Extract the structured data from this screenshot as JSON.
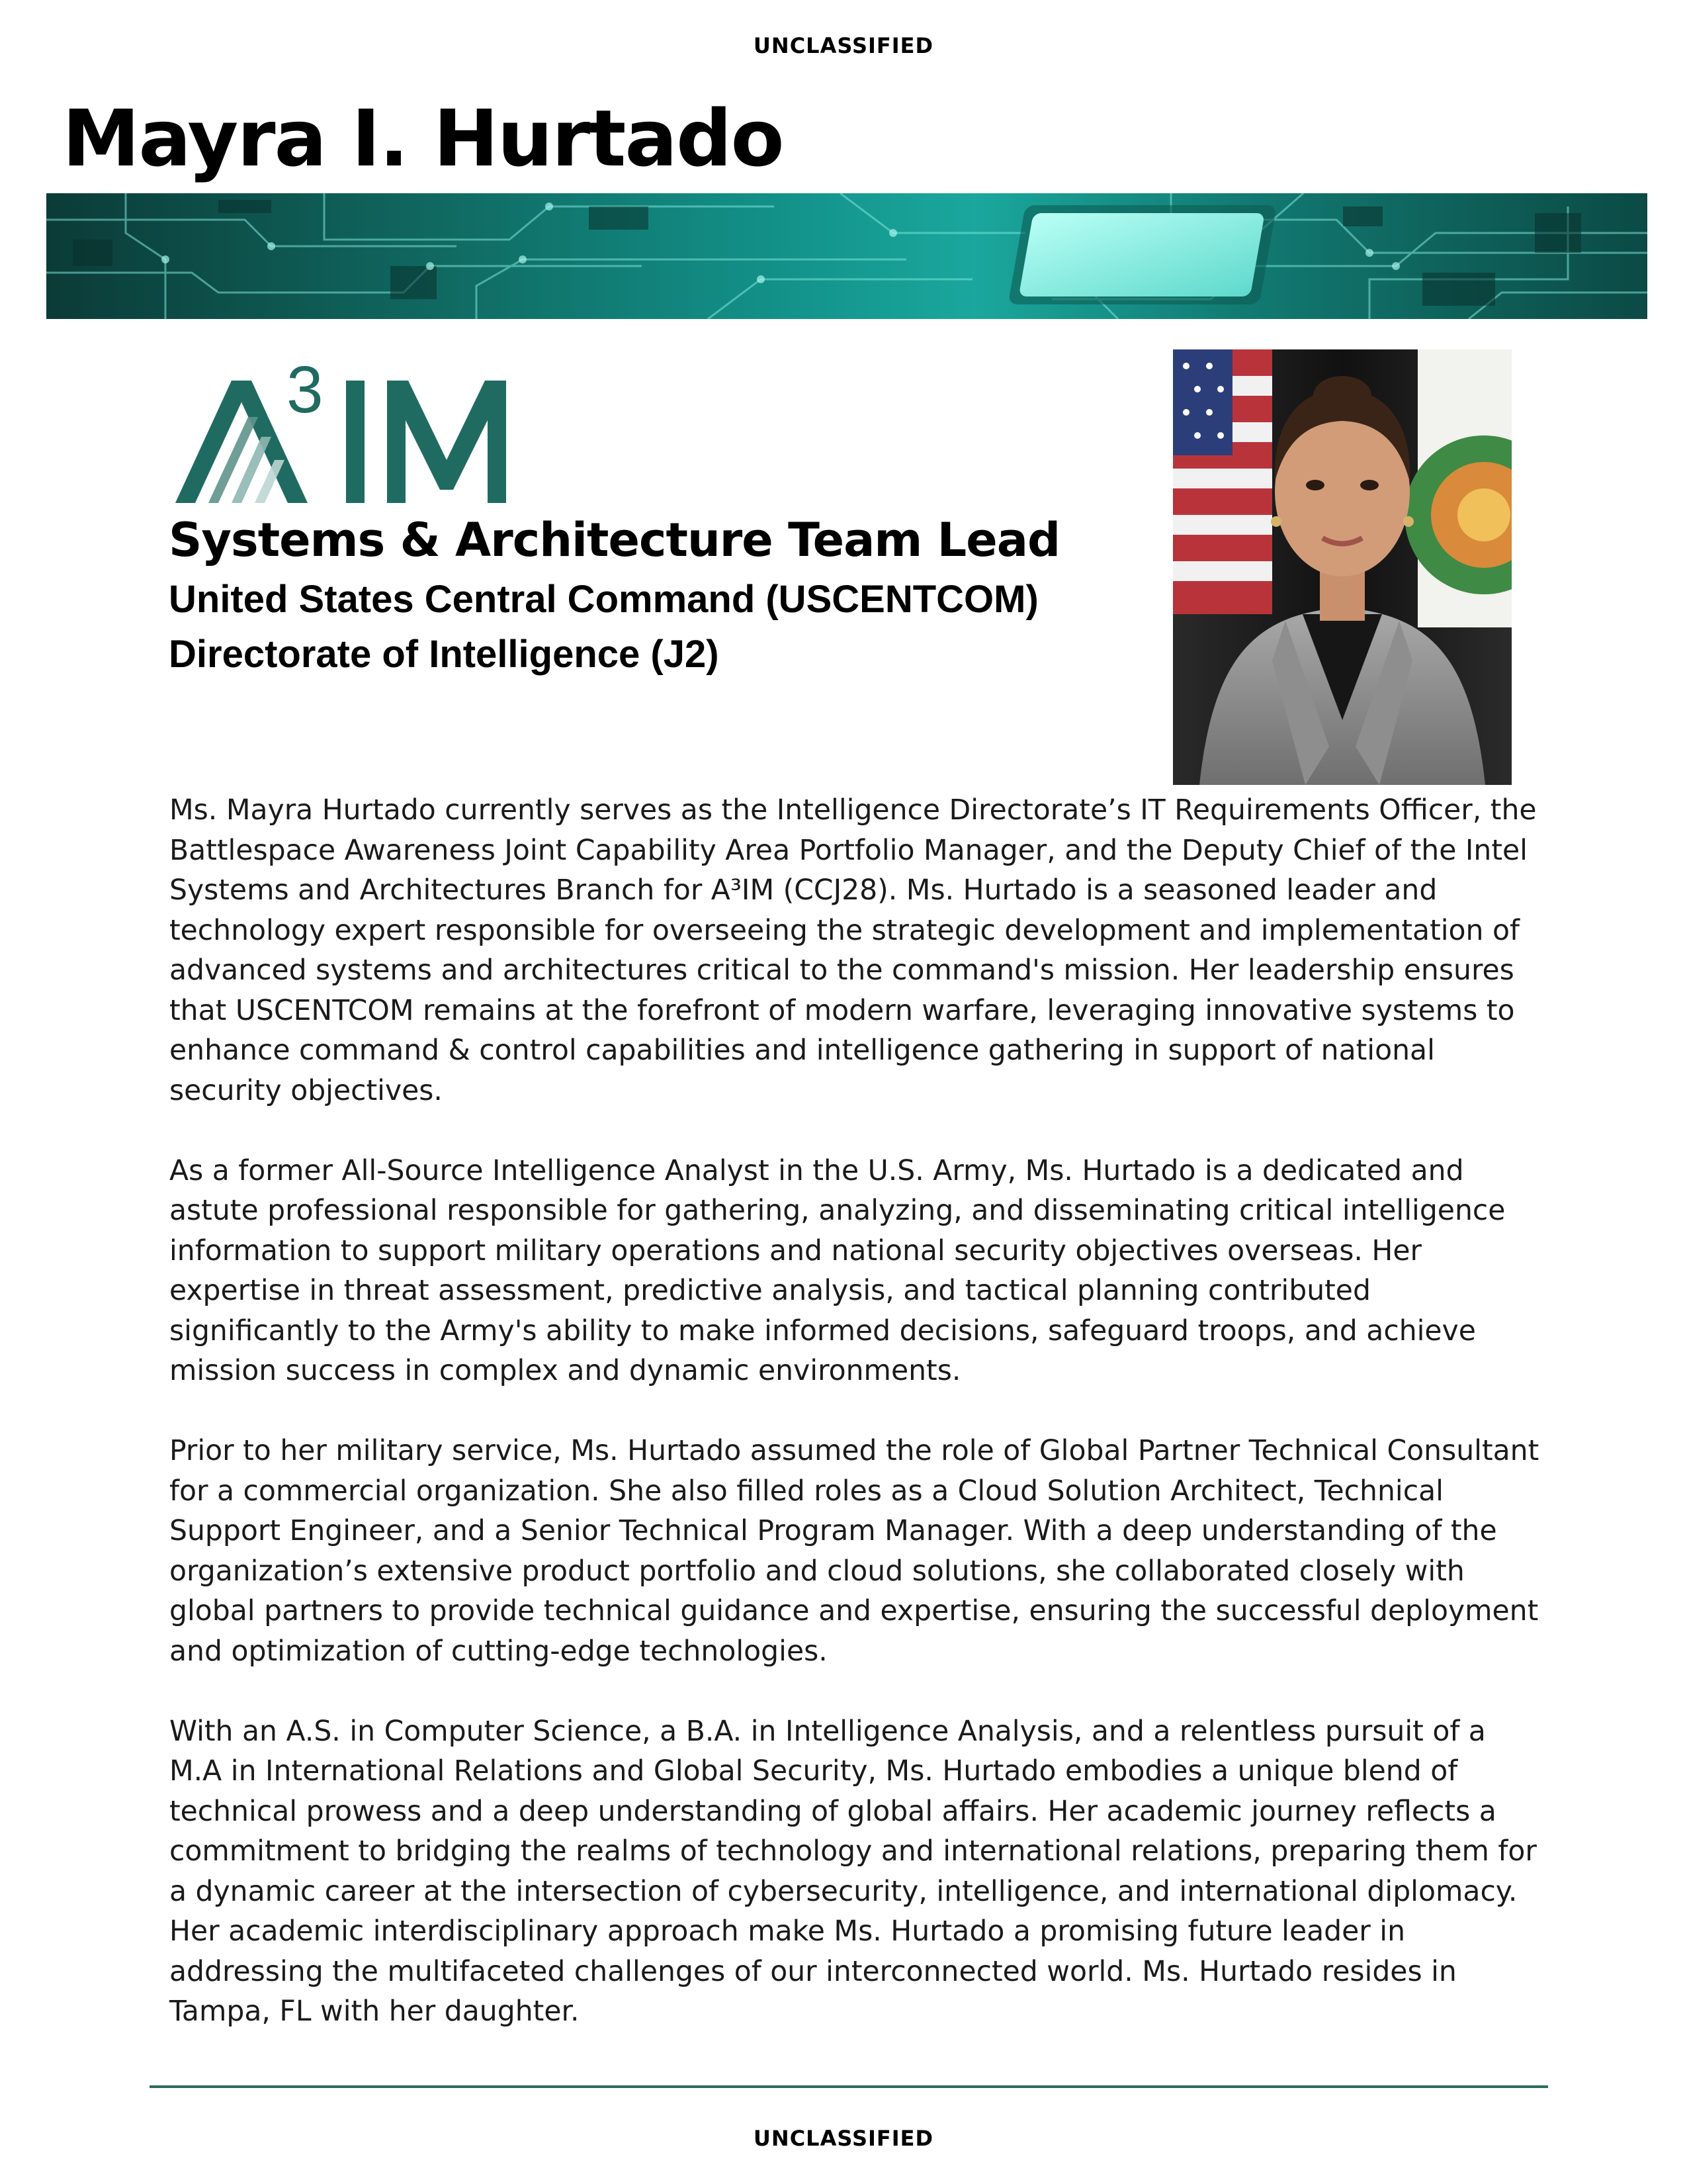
{
  "classification": {
    "top": "UNCLASSIFIED",
    "bottom": "UNCLASSIFIED"
  },
  "person": {
    "name": "Mayra I. Hurtado"
  },
  "logo": {
    "text": "A3IM",
    "color": "#1f6b62"
  },
  "role": {
    "title": "Systems & Architecture Team Lead",
    "organization": "United States Central Command (USCENTCOM)",
    "directorate": "Directorate of Intelligence (J2)"
  },
  "biography": {
    "paragraphs": [
      "Ms. Mayra Hurtado currently serves as the Intelligence Directorate’s IT Requirements Officer, the Battlespace Awareness Joint Capability Area Portfolio Manager, and the Deputy Chief of the Intel Systems and Architectures Branch for A³IM (CCJ28). Ms. Hurtado is a seasoned leader and technology expert responsible for overseeing the strategic development and implementation of advanced systems and architectures critical to the command's mission. Her leadership ensures that USCENTCOM remains at the forefront of modern warfare, leveraging innovative systems to enhance command & control capabilities and intelligence gathering in support of national security objectives.",
      "As a former All-Source Intelligence Analyst in the U.S. Army, Ms. Hurtado is a dedicated and astute professional responsible for gathering, analyzing, and disseminating critical intelligence information to support military operations and national security objectives overseas. Her expertise in threat assessment, predictive analysis, and tactical planning contributed significantly to the Army's ability to make informed decisions, safeguard troops, and achieve mission success in complex and dynamic environments.",
      "Prior to her military service, Ms. Hurtado assumed the role of Global Partner Technical Consultant for a commercial organization. She also filled roles as a Cloud Solution Architect, Technical Support Engineer, and a Senior Technical Program Manager. With a deep understanding of the organization’s extensive product portfolio and cloud solutions, she collaborated closely with global partners to provide technical guidance and expertise, ensuring the successful deployment and optimization of cutting-edge technologies.",
      "With an A.S. in Computer Science, a B.A. in Intelligence Analysis, and a relentless pursuit of a M.A in International Relations and Global Security, Ms. Hurtado embodies a unique blend of technical prowess and a deep understanding of global affairs. Her academic journey reflects a commitment to bridging the realms of technology and international relations, preparing them for a dynamic career at the intersection of cybersecurity, intelligence, and international diplomacy. Her academic interdisciplinary approach make Ms. Hurtado a promising future leader in addressing the multifaceted challenges of our interconnected world. Ms. Hurtado resides in Tampa, FL with her daughter."
    ]
  },
  "colors": {
    "accent": "#1f6b62",
    "banner": "#129088",
    "rule": "#2a6b5c"
  }
}
